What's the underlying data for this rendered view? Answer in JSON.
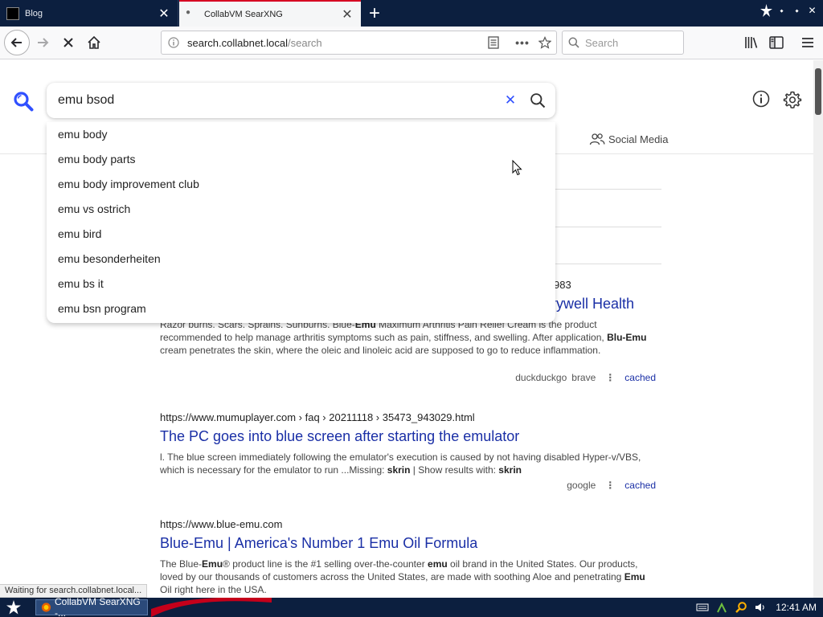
{
  "browser": {
    "tabs": [
      {
        "title": "Blog"
      },
      {
        "title": "CollabVM SearXNG"
      }
    ],
    "url_host": "search.collabnet.local",
    "url_path": "/search",
    "search_placeholder": "Search",
    "status_text": "Waiting for search.collabnet.local..."
  },
  "search": {
    "query": "emu bsod",
    "suggestions": [
      "emu body",
      "emu body parts",
      "emu body improvement club",
      "emu vs ostrich",
      "emu bird",
      "emu besonderheiten",
      "emu bs it",
      "emu bsn program"
    ]
  },
  "categories": {
    "files_partial": "iles",
    "social": "Social Media"
  },
  "results": [
    {
      "url_partial": "983",
      "title_partial": "erywell Health",
      "content": "Razor burns. Scars. Sprains. Sunburns. Blue-<b>Emu</b> Maximum Arthritis Pain Relief Cream is the product recommended to help manage arthritis symptoms such as pain, stiffness, and swelling. After application, <b>Blu-Emu</b> cream penetrates the skin, where the oleic and linoleic acid are supposed to go to reduce inflammation.",
      "engines": [
        "duckduckgo",
        "brave"
      ],
      "cached": "cached"
    },
    {
      "url": "https://www.mumuplayer.com  › faq › 20211118 › 35473_943029.html",
      "title": "The PC goes into blue screen after starting the emulator",
      "content": "l. The blue screen immediately following the emulator's execution is caused by not having disabled Hyper-v/VBS, which is necessary for the emulator to run ...Missing: <b>skrin</b> | Show results with: <b>skrin</b>",
      "engines": [
        "google"
      ],
      "cached": "cached"
    },
    {
      "url": "https://www.blue-emu.com",
      "title": "Blue-Emu | America's Number 1 Emu Oil Formula",
      "content": "The Blue-<b>Emu</b>® product line is the #1 selling over-the-counter <b>emu</b> oil brand in the United States. Our products, loved by our thousands of customers across the United States, are made with soothing Aloe and penetrating <b>Emu</b> Oil right here in the USA."
    }
  ],
  "taskbar": {
    "task_label": "CollabVM SearXNG -...",
    "clock": "12:41 AM"
  },
  "colors": {
    "accent": "#3050ff",
    "link": "#1a2fa6",
    "os_bar": "#0c1f3f"
  }
}
